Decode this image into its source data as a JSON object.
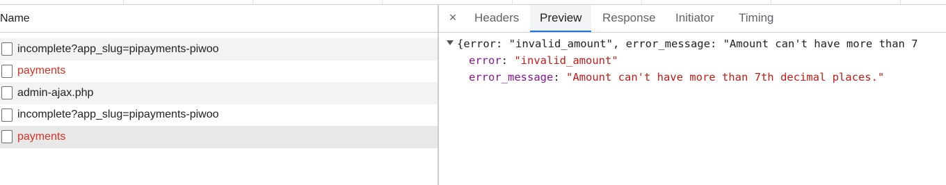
{
  "request_list": {
    "column_header": "Name",
    "rows": [
      {
        "name": "incomplete?app_slug=pipayments-piwoo",
        "error": false
      },
      {
        "name": "payments",
        "error": true
      },
      {
        "name": "admin-ajax.php",
        "error": false
      },
      {
        "name": "incomplete?app_slug=pipayments-piwoo",
        "error": false
      },
      {
        "name": "payments",
        "error": true,
        "selected": true
      }
    ]
  },
  "detail_panel": {
    "close_glyph": "×",
    "tabs": [
      {
        "label": "Headers",
        "active": false
      },
      {
        "label": "Preview",
        "active": true
      },
      {
        "label": "Response",
        "active": false
      },
      {
        "label": "Initiator",
        "active": false
      },
      {
        "label": "Timing",
        "active": false
      }
    ],
    "preview": {
      "summary": "{error: \"invalid_amount\", error_message: \"Amount can't have more than 7",
      "properties": [
        {
          "key": "error",
          "value": "\"invalid_amount\""
        },
        {
          "key": "error_message",
          "value": "\"Amount can't have more than 7th decimal places.\""
        }
      ]
    }
  },
  "colors": {
    "error_text": "#d93025",
    "json_key": "#881391",
    "json_string": "#c41a16",
    "active_tab_underline": "#1a73e8"
  }
}
